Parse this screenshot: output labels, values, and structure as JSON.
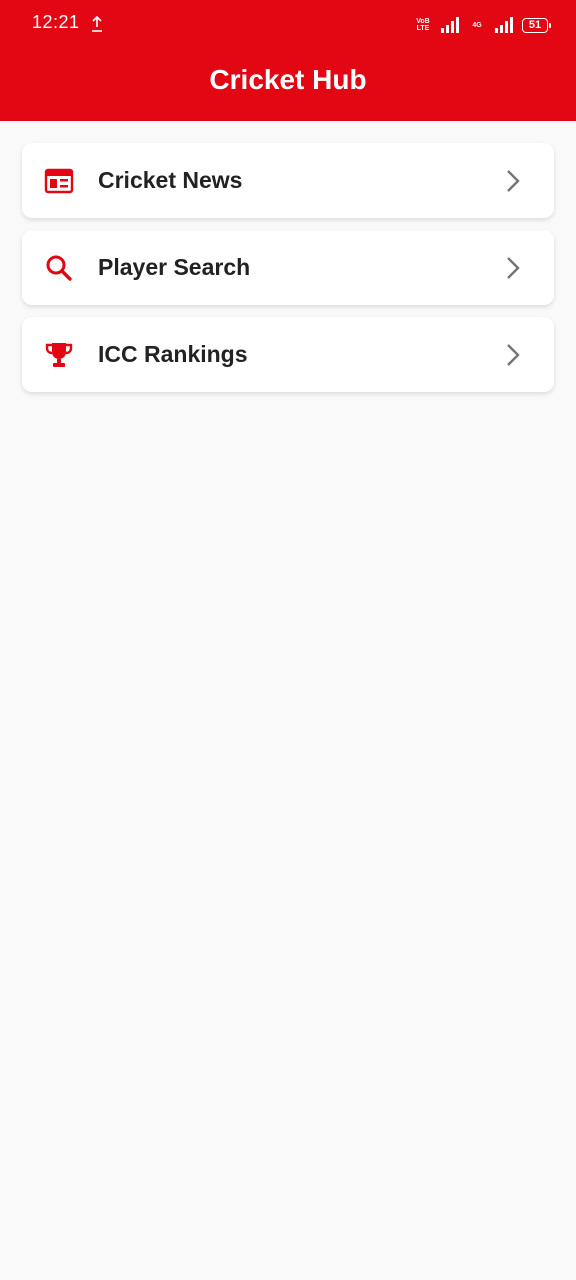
{
  "status_bar": {
    "time": "12:21",
    "volte_label": "VoB LTE",
    "lte_label": "4G",
    "battery": "51",
    "icons": [
      "upload-icon",
      "volte-icon",
      "signal-icon",
      "lte-icon",
      "signal-icon",
      "battery-icon"
    ]
  },
  "header": {
    "title": "Cricket Hub"
  },
  "colors": {
    "primary": "#e30613",
    "background": "#f9f9f9",
    "card": "#ffffff",
    "text": "#222222",
    "chevron": "#757575"
  },
  "menu": {
    "items": [
      {
        "label": "Cricket News",
        "icon": "newspaper-icon"
      },
      {
        "label": "Player Search",
        "icon": "search-icon"
      },
      {
        "label": "ICC Rankings",
        "icon": "trophy-icon"
      }
    ]
  }
}
